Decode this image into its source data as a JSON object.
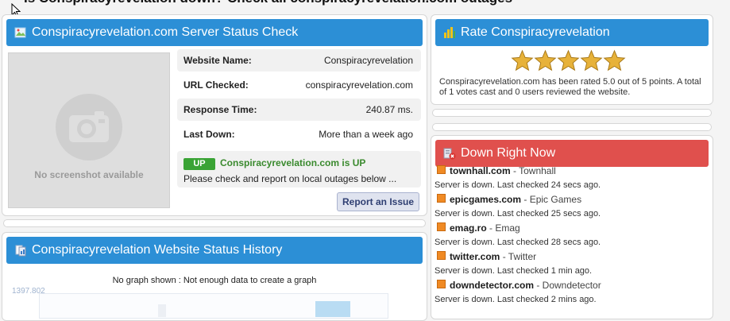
{
  "page": {
    "headline": "Is Conspiracyrevelation down? Check all conspiracyrevelation.com outages"
  },
  "status_check": {
    "title": "Conspiracyrevelation.com Server Status Check",
    "screenshot_label": "No screenshot available",
    "rows": [
      {
        "key": "Website Name:",
        "value": "Conspiracyrevelation"
      },
      {
        "key": "URL Checked:",
        "value": "conspiracyrevelation.com"
      },
      {
        "key": "Response Time:",
        "value": "240.87 ms."
      },
      {
        "key": "Last Down:",
        "value": "More than a week ago"
      }
    ],
    "badge": "UP",
    "status_text": "Conspiracyrevelation.com is UP",
    "description": "Please check and report on local outages below ...",
    "report_button": "Report an Issue"
  },
  "rate": {
    "title": "Rate Conspiracyrevelation",
    "stars": 5,
    "rating_text": "Conspiracyrevelation.com has been rated 5.0 out of 5 points. A total of 1 votes cast and 0 users reviewed the website."
  },
  "down_now": {
    "title": "Down Right Now",
    "items": [
      {
        "site": "townhall.com",
        "name": " - Townhall",
        "status": "Server is down. Last checked 24 secs ago."
      },
      {
        "site": "epicgames.com",
        "name": " - Epic Games",
        "status": "Server is down. Last checked 25 secs ago."
      },
      {
        "site": "emag.ro",
        "name": " - Emag",
        "status": "Server is down. Last checked 28 secs ago."
      },
      {
        "site": "twitter.com",
        "name": " - Twitter",
        "status": "Server is down. Last checked 1 min ago."
      },
      {
        "site": "downdetector.com",
        "name": " - Downdetector",
        "status": "Server is down. Last checked 2 mins ago."
      }
    ]
  },
  "history": {
    "title": "Conspiracyrevelation Website Status History",
    "message": "No graph shown : Not enough data to create a graph",
    "axis_label": "1397.802"
  },
  "colors": {
    "bar_blue": "#2c8fd6",
    "bar_red": "#e0504d",
    "up_green": "#3aa335",
    "star_gold": "#e7b23a"
  }
}
